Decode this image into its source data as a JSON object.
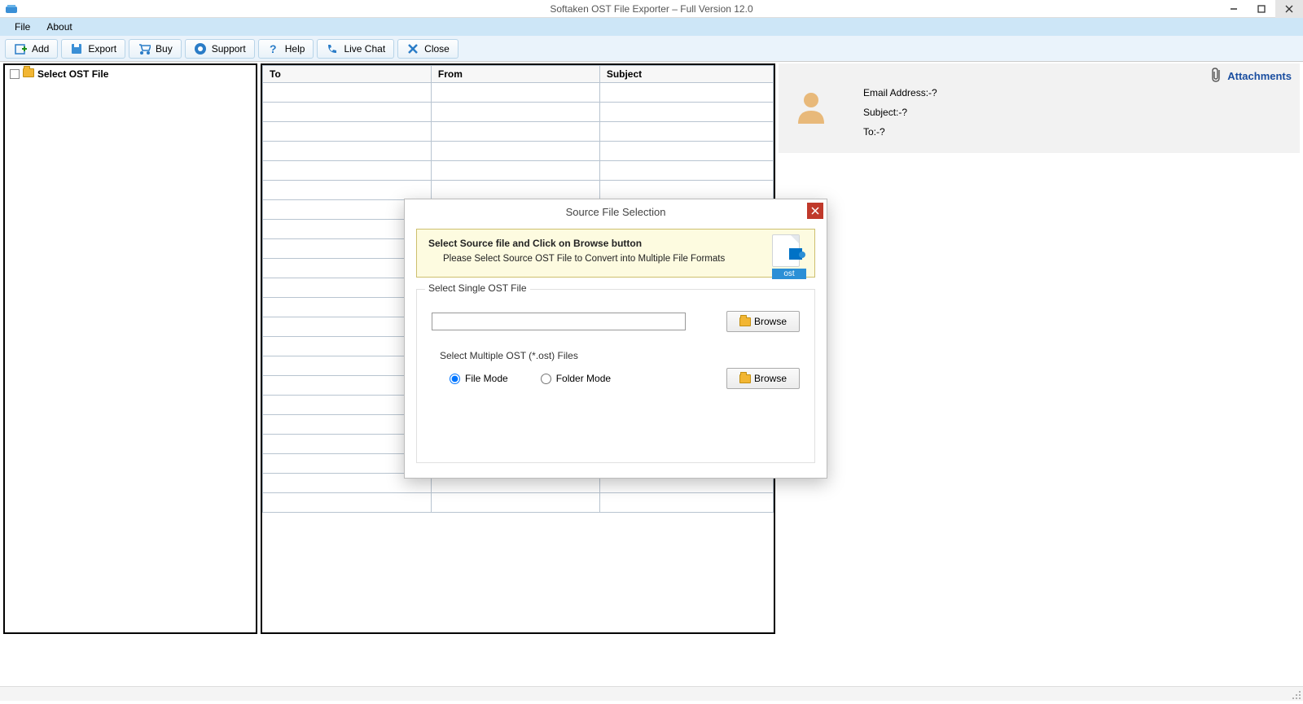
{
  "app": {
    "title": "Softaken OST File Exporter – Full Version 12.0"
  },
  "menu": {
    "file": "File",
    "about": "About"
  },
  "toolbar": {
    "add": "Add",
    "export": "Export",
    "buy": "Buy",
    "support": "Support",
    "help": "Help",
    "livechat": "Live Chat",
    "close": "Close"
  },
  "tree": {
    "root": "Select OST File"
  },
  "table": {
    "headers": {
      "to": "To",
      "from": "From",
      "subject": "Subject"
    }
  },
  "preview": {
    "attachments": "Attachments",
    "email_label": "Email Address:-?",
    "subject_label": "Subject:-?",
    "to_label": "To:-?"
  },
  "dialog": {
    "title": "Source File Selection",
    "banner_title": "Select Source file and Click on Browse button",
    "banner_sub": "Please Select Source OST File to Convert into Multiple File Formats",
    "ost_badge": "ost",
    "group1_title": "Select Single OST File",
    "browse1": "Browse",
    "group2_title": "Select Multiple OST (*.ost) Files",
    "radio_file": "File Mode",
    "radio_folder": "Folder Mode",
    "browse2": "Browse"
  }
}
